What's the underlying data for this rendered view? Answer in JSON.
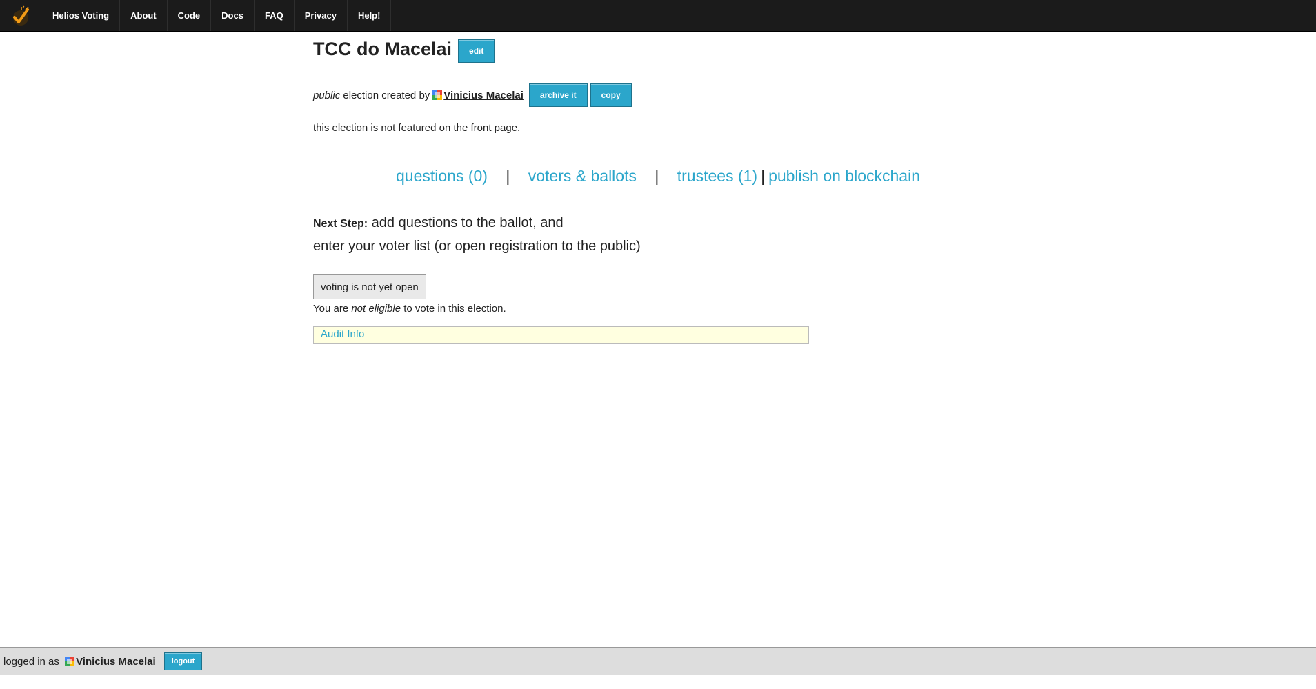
{
  "nav": {
    "logo_icon": "helios-logo-icon",
    "items": [
      {
        "label": "Helios Voting"
      },
      {
        "label": "About"
      },
      {
        "label": "Code"
      },
      {
        "label": "Docs"
      },
      {
        "label": "FAQ"
      },
      {
        "label": "Privacy"
      },
      {
        "label": "Help!"
      }
    ]
  },
  "election": {
    "title": "TCC do Macelai",
    "edit_label": "edit",
    "visibility": "public",
    "created_by_text": " election created by",
    "creator": "Vinicius Macelai",
    "archive_label": "archive it",
    "copy_label": "copy",
    "featured_prefix": "this election is ",
    "featured_not": "not",
    "featured_suffix": " featured on the front page."
  },
  "tabs": {
    "questions": "questions (0)",
    "voters": "voters & ballots",
    "trustees": "trustees (1)",
    "publish": "publish on blockchain",
    "separator": "|"
  },
  "next_step": {
    "label": "Next Step:",
    "line1": " add questions to the ballot, and",
    "line2": "enter your voter list (or open registration to the public)"
  },
  "voting": {
    "status_button": "voting is not yet open",
    "eligible_prefix": "You are ",
    "eligible_em": "not eligible",
    "eligible_suffix": " to vote in this election."
  },
  "audit": {
    "label": "Audit Info"
  },
  "footer": {
    "prefix": "logged in as ",
    "user": "Vinicius Macelai",
    "logout_label": "logout"
  },
  "colors": {
    "accent": "#2ba6cb",
    "topbar": "#1b1b1b",
    "footer": "#dddddd",
    "audit_bg": "#ffffe0"
  }
}
